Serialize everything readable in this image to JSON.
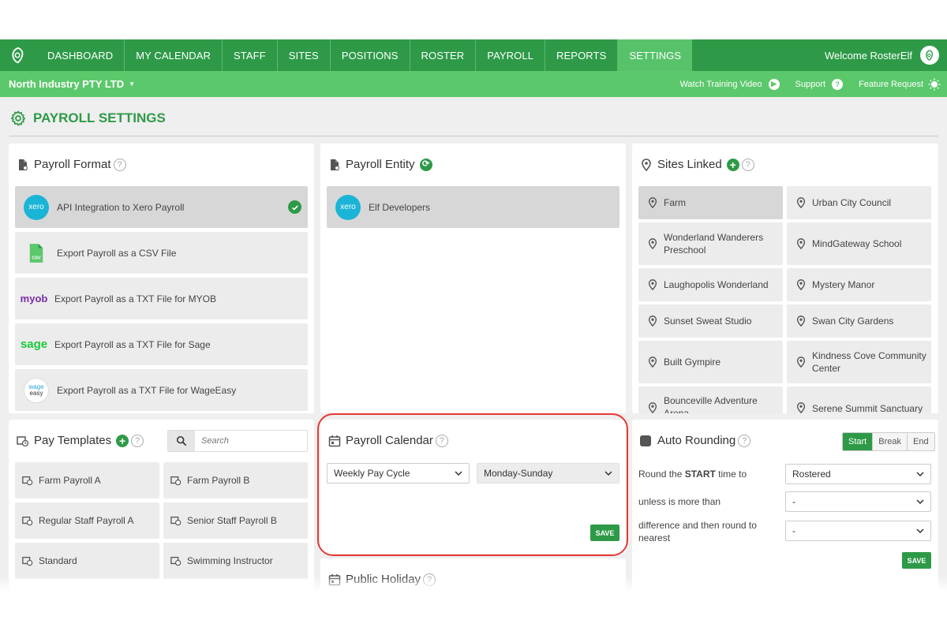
{
  "nav": {
    "items": [
      {
        "label": "DASHBOARD"
      },
      {
        "label": "MY CALENDAR"
      },
      {
        "label": "STAFF"
      },
      {
        "label": "SITES"
      },
      {
        "label": "POSITIONS"
      },
      {
        "label": "ROSTER"
      },
      {
        "label": "PAYROLL"
      },
      {
        "label": "REPORTS"
      },
      {
        "label": "SETTINGS",
        "active": true
      }
    ],
    "welcome": "Welcome RosterElf"
  },
  "subbar": {
    "company": "North Industry PTY LTD",
    "links": [
      "Watch Training Video",
      "Support",
      "Feature Request"
    ]
  },
  "page": {
    "title": "PAYROLL SETTINGS"
  },
  "payroll_format": {
    "title": "Payroll Format",
    "items": [
      {
        "brand": "xero",
        "label": "API Integration to Xero Payroll",
        "selected": true
      },
      {
        "brand": "CSV",
        "label": "Export Payroll as a CSV File"
      },
      {
        "brand": "myob",
        "label": "Export Payroll as a TXT File for MYOB"
      },
      {
        "brand": "sage",
        "label": "Export Payroll as a TXT File for Sage"
      },
      {
        "brand": "wage easy",
        "label": "Export Payroll as a TXT File for WageEasy"
      }
    ]
  },
  "payroll_entity": {
    "title": "Payroll Entity",
    "items": [
      {
        "brand": "xero",
        "label": "Elf Developers"
      }
    ]
  },
  "sites_linked": {
    "title": "Sites Linked",
    "items": [
      "Farm",
      "Urban City Council",
      "Wonderland Wanderers Preschool",
      "MindGateway School",
      "Laughopolis Wonderland",
      "Mystery Manor",
      "Sunset Sweat Studio",
      "Swan City Gardens",
      "Built Gympire",
      "Kindness Cove Community Center",
      "Bounceville Adventure Arena",
      "Serene Summit Sanctuary"
    ]
  },
  "pay_templates": {
    "title": "Pay Templates",
    "search_placeholder": "Search",
    "items": [
      "Farm Payroll A",
      "Farm Payroll B",
      "Regular Staff Payroll A",
      "Senior Staff Payroll B",
      "Standard",
      "Swimming Instructor"
    ]
  },
  "payroll_calendar": {
    "title": "Payroll Calendar",
    "cycle": "Weekly Pay Cycle",
    "week": "Monday-Sunday",
    "save": "SAVE"
  },
  "public_holiday": {
    "title": "Public Holiday"
  },
  "auto_rounding": {
    "title": "Auto Rounding",
    "tabs": [
      "Start",
      "Break",
      "End"
    ],
    "round_label_pre": "Round the ",
    "round_label_bold": "START",
    "round_label_post": " time to",
    "round_value": "Rostered",
    "unless_label": "unless is more than",
    "unless_value": "-",
    "difference_label": "difference and then round to nearest",
    "difference_value": "-",
    "save": "SAVE"
  },
  "colors": {
    "brand_green": "#2e9a48",
    "light_green": "#5cc86c",
    "highlight": "#e53935"
  }
}
